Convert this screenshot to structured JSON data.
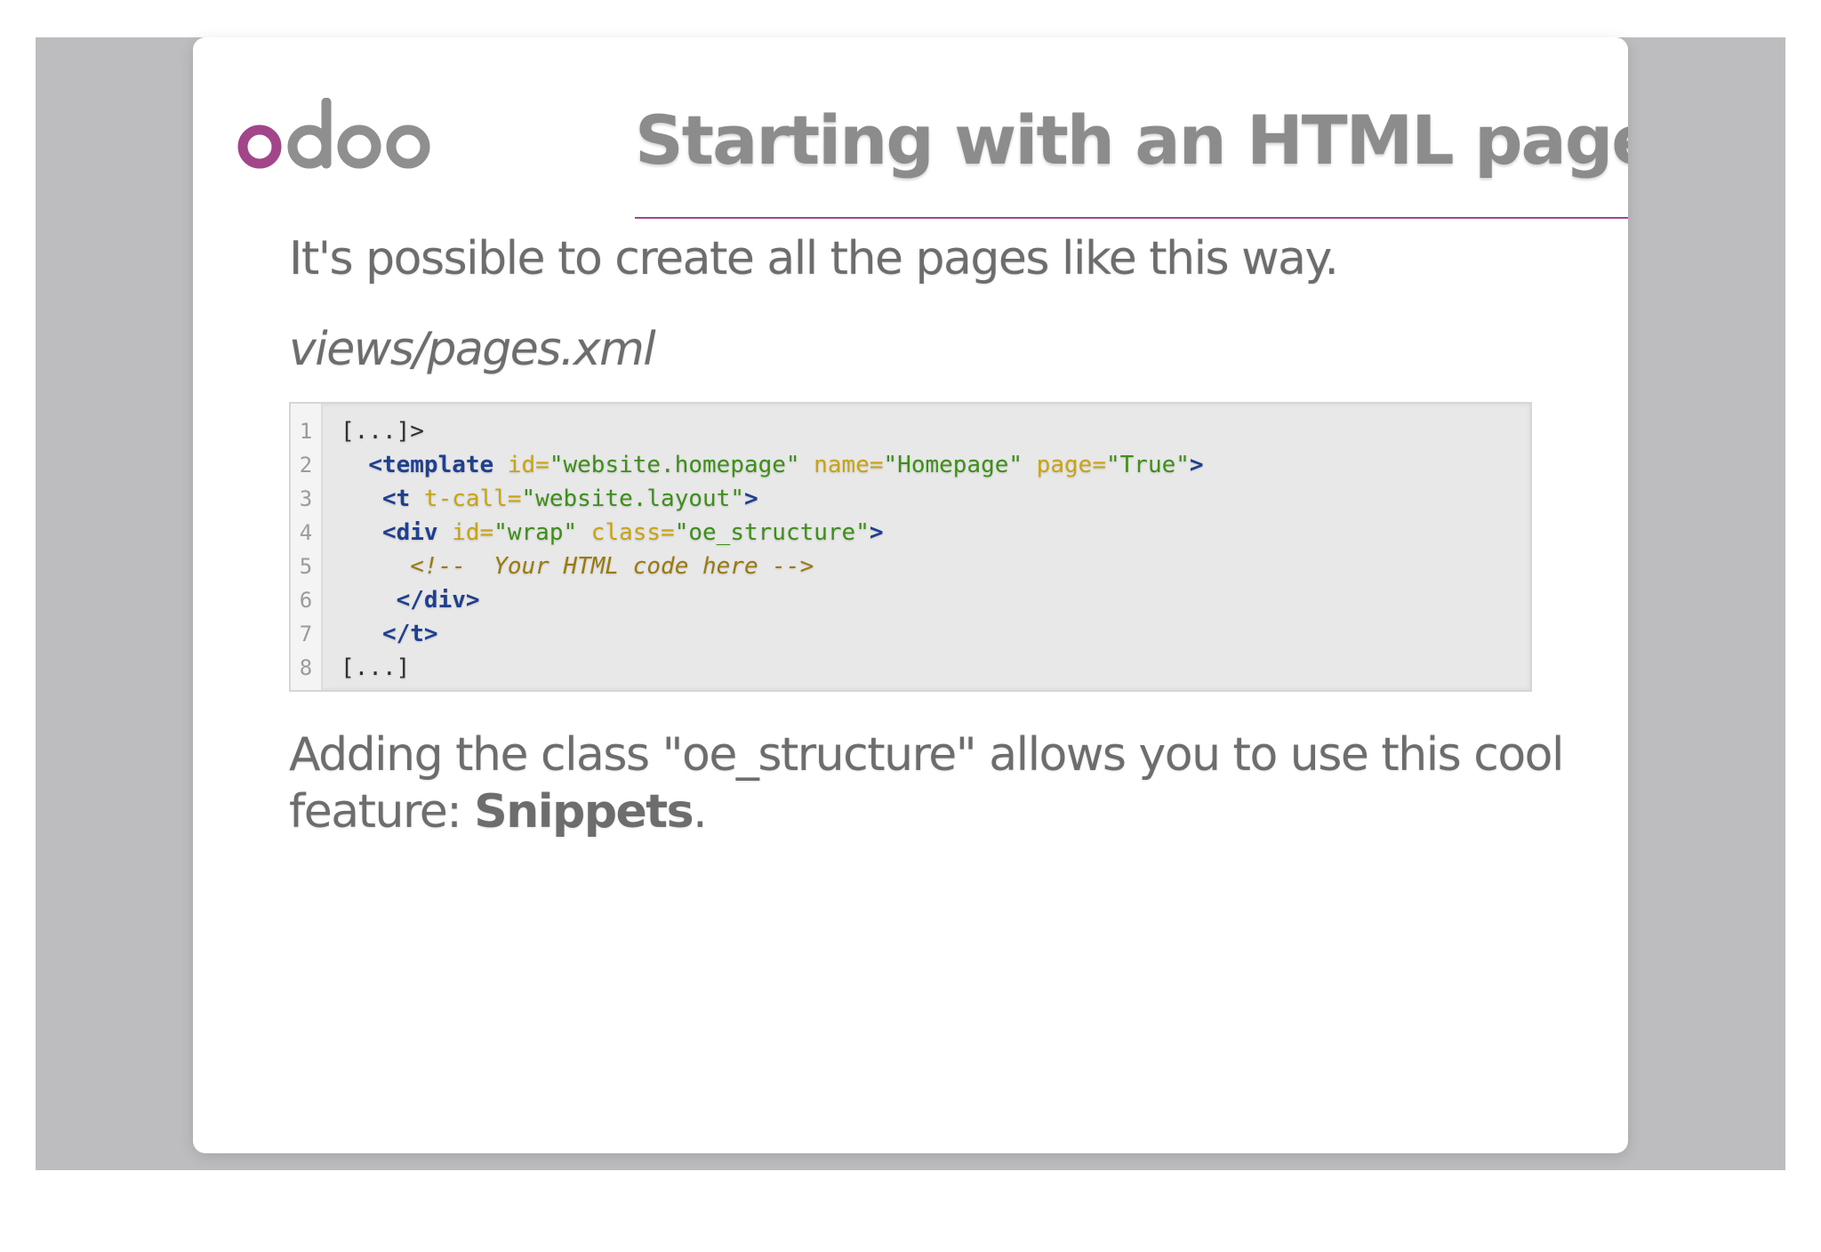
{
  "logo": {
    "text": "odoo"
  },
  "title": "Starting with an HTML page",
  "intro": "It's possible to create all the pages like this way.",
  "filename": "views/pages.xml",
  "code": {
    "line_numbers": [
      "1",
      "2",
      "3",
      "4",
      "5",
      "6",
      "7",
      "8"
    ],
    "lines": [
      {
        "indent": "",
        "parts": [
          {
            "t": "[...]>",
            "c": ""
          }
        ]
      },
      {
        "indent": "  ",
        "parts": [
          {
            "t": "<template",
            "c": "tg"
          },
          {
            "t": " id=",
            "c": "at"
          },
          {
            "t": "\"website.homepage\"",
            "c": "av"
          },
          {
            "t": " name=",
            "c": "at"
          },
          {
            "t": "\"Homepage\"",
            "c": "av"
          },
          {
            "t": " page=",
            "c": "at"
          },
          {
            "t": "\"True\"",
            "c": "av"
          },
          {
            "t": ">",
            "c": "tg"
          }
        ]
      },
      {
        "indent": "   ",
        "parts": [
          {
            "t": "<t",
            "c": "tg"
          },
          {
            "t": " t-call=",
            "c": "at"
          },
          {
            "t": "\"website.layout\"",
            "c": "av"
          },
          {
            "t": ">",
            "c": "tg"
          }
        ]
      },
      {
        "indent": "   ",
        "parts": [
          {
            "t": "<div",
            "c": "tg"
          },
          {
            "t": " id=",
            "c": "at"
          },
          {
            "t": "\"wrap\"",
            "c": "av"
          },
          {
            "t": " class=",
            "c": "at"
          },
          {
            "t": "\"oe_structure\"",
            "c": "av"
          },
          {
            "t": ">",
            "c": "tg"
          }
        ]
      },
      {
        "indent": "     ",
        "parts": [
          {
            "t": "<!--  Your HTML code here -->",
            "c": "cm"
          }
        ]
      },
      {
        "indent": "    ",
        "parts": [
          {
            "t": "</div>",
            "c": "tg"
          }
        ]
      },
      {
        "indent": "   ",
        "parts": [
          {
            "t": "</t>",
            "c": "tg"
          }
        ]
      },
      {
        "indent": "",
        "parts": [
          {
            "t": "[...]",
            "c": ""
          }
        ]
      }
    ]
  },
  "outro": {
    "text": "Adding the class \"oe_structure\" allows you to use this cool feature: ",
    "emphasis": "Snippets",
    "end": "."
  },
  "colors": {
    "accent": "#a24689",
    "title": "#8c8c8c",
    "body_text": "#6d6d6d",
    "backdrop": "#bdbcbe"
  }
}
